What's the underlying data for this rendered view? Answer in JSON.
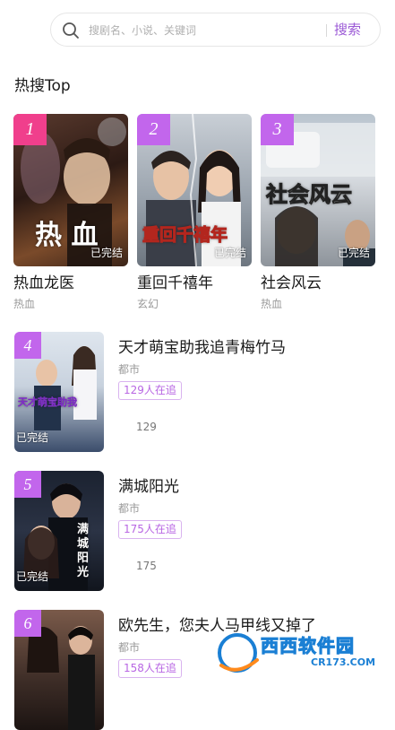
{
  "search": {
    "placeholder": "搜剧名、小说、关键词",
    "button_label": "搜索"
  },
  "section": {
    "title": "热搜Top"
  },
  "colors": {
    "accent": "#9b59d6",
    "rank_badge": "#c266ec",
    "rank_badge_top": "#f03f8c",
    "tag_text": "#b866e3"
  },
  "top_cards": [
    {
      "rank": "1",
      "title": "热血龙医",
      "genre": "热血",
      "status": "已完结",
      "cover_text": "热 血"
    },
    {
      "rank": "2",
      "title": "重回千禧年",
      "genre": "玄幻",
      "status": "已完结",
      "cover_text": "重回千禧年"
    },
    {
      "rank": "3",
      "title": "社会风云",
      "genre": "热血",
      "status": "已完结",
      "cover_text": "社会风云"
    }
  ],
  "list_items": [
    {
      "rank": "4",
      "title": "天才萌宝助我追青梅竹马",
      "genre": "都市",
      "tag": "129人在追",
      "count": "129",
      "status": "已完结",
      "cover_text": "天才萌宝助我"
    },
    {
      "rank": "5",
      "title": "满城阳光",
      "genre": "都市",
      "tag": "175人在追",
      "count": "175",
      "status": "已完结",
      "cover_text": "满城阳光"
    },
    {
      "rank": "6",
      "title": "欧先生，您夫人马甲线又掉了",
      "genre": "都市",
      "tag": "158人在追",
      "count": "",
      "status": "",
      "cover_text": ""
    }
  ],
  "watermark": {
    "text": "西西软件园",
    "sub": "CR173.COM"
  }
}
